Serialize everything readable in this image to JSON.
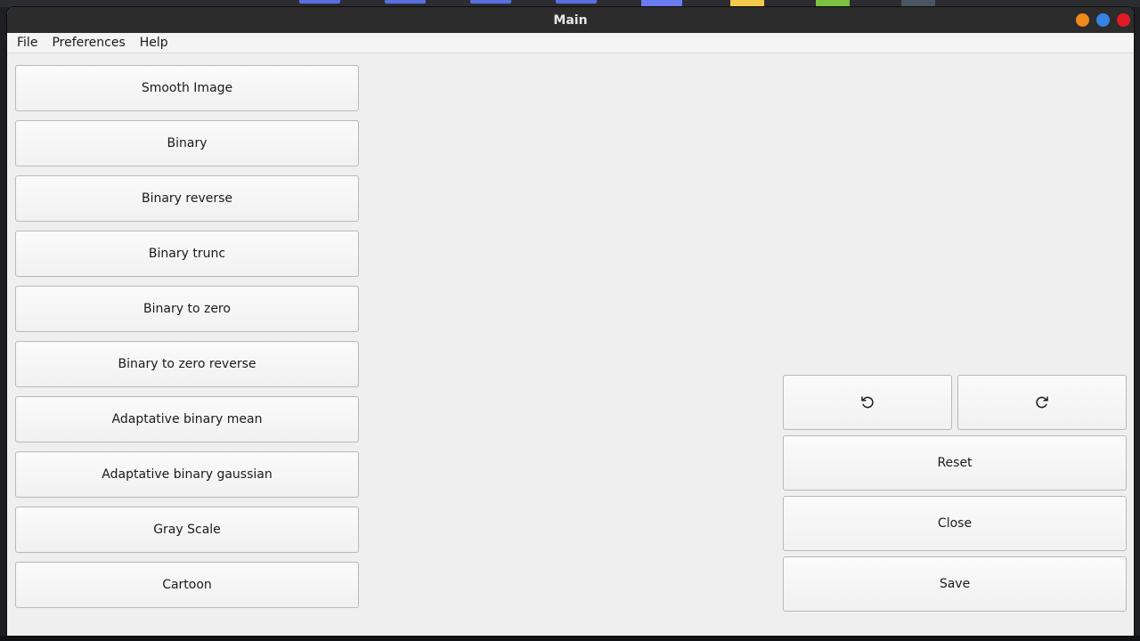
{
  "window": {
    "title": "Main"
  },
  "menu": [
    "File",
    "Preferences",
    "Help"
  ],
  "filters": [
    "Smooth Image",
    "Binary",
    "Binary reverse",
    "Binary trunc",
    "Binary to zero",
    "Binary to zero reverse",
    "Adaptative binary mean",
    "Adaptative binary gaussian",
    "Gray Scale",
    "Cartoon"
  ],
  "actions": {
    "undo_icon": "rotate-left-icon",
    "redo_icon": "rotate-right-icon",
    "reset": "Reset",
    "close": "Close",
    "save": "Save"
  },
  "colors": {
    "titlebar": "#2c2c2c",
    "wm_minimize": "#f08a1c",
    "wm_maximize": "#3584e4",
    "wm_close": "#e01b24"
  }
}
